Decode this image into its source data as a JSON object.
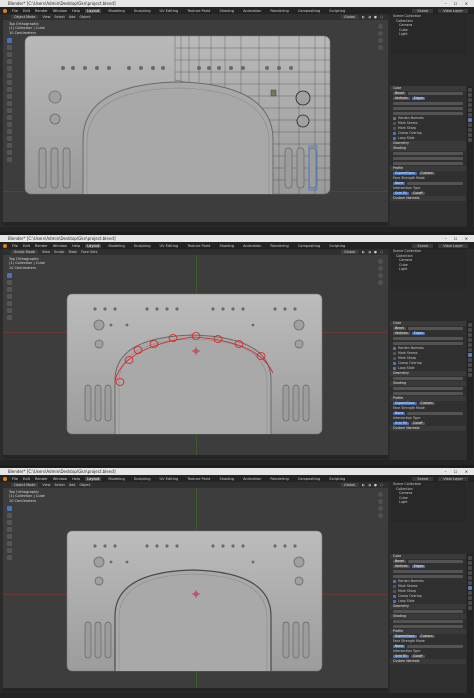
{
  "titlebar": {
    "title": "Blender* [C:\\Users\\Admin\\Desktop\\Gkn\\project.blend]",
    "controls": "–  ☐  ✕"
  },
  "menu": {
    "items": [
      "File",
      "Edit",
      "Render",
      "Window",
      "Help"
    ],
    "workspaces": [
      "Layout",
      "Modeling",
      "Sculpting",
      "UV Editing",
      "Texture Paint",
      "Shading",
      "Animation",
      "Rendering",
      "Compositing",
      "Scripting"
    ],
    "active_workspace": "Layout",
    "scene": "Scene",
    "view_layer": "View Layer"
  },
  "panels": [
    {
      "mode": "Object Mode",
      "view_menu": [
        "View",
        "Select",
        "Add",
        "Object"
      ],
      "overlay_lines": [
        "Top Orthographic",
        "(1) Collection | Cube",
        "10 Centimeters"
      ],
      "pill": "Global"
    },
    {
      "mode": "Sculpt Mode",
      "view_menu": [
        "View",
        "Sculpt",
        "Mask",
        "Face Sets"
      ],
      "overlay_lines": [
        "Top Orthographic",
        "(1) Collection | Cube",
        "10 Centimeters"
      ],
      "pill": "Global"
    },
    {
      "mode": "Object Mode",
      "view_menu": [
        "View",
        "Select",
        "Add",
        "Object"
      ],
      "overlay_lines": [
        "Top Orthographic",
        "(1) Collection | Cube",
        "10 Centimeters"
      ],
      "pill": "Global"
    }
  ],
  "outliner": {
    "rows": [
      "Scene Collection",
      "Collection",
      "Camera",
      "Cube",
      "Light"
    ]
  },
  "properties": {
    "object_name": "Cube",
    "modifier": "Bevel",
    "sections": [
      "Geometry",
      "Shading",
      "Profile",
      "Face Strength Mode",
      "Intersection Type",
      "Custom Normals"
    ],
    "checks": [
      "Harden Normals",
      "Mark Seams",
      "Mark Sharp",
      "Clamp Overlap",
      "Loop Slide"
    ],
    "buttons": [
      "Vertices",
      "Edges",
      "Offset",
      "Percent",
      "Superellipse",
      "Custom",
      "None",
      "Grid Fill",
      "Cutoff"
    ]
  },
  "colors": {
    "accent": "#4a72b8",
    "annotation": "#e01e1e",
    "brand": "#e87d0d"
  },
  "icons": [
    "blender-logo-icon",
    "select-box-icon",
    "move-icon",
    "rotate-icon",
    "scale-icon",
    "annotate-icon",
    "zoom-icon",
    "hand-icon",
    "camera-icon",
    "grid-icon",
    "scene-icon"
  ]
}
